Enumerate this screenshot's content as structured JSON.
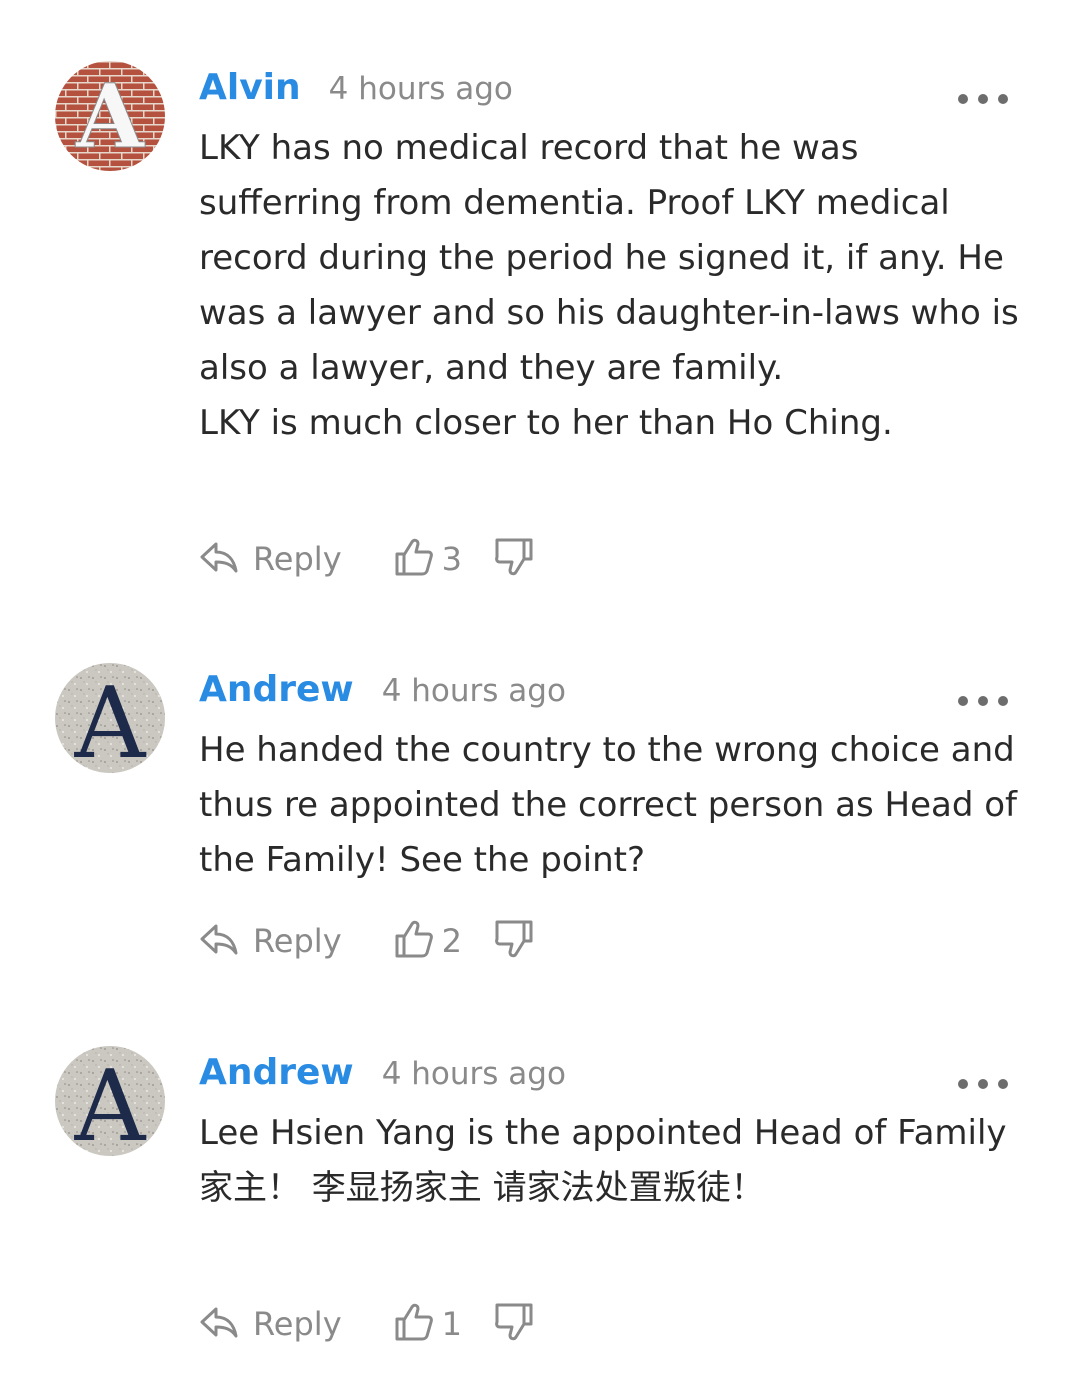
{
  "comments": [
    {
      "author": "Alvin",
      "time": "4 hours ago",
      "avatar_letter": "A",
      "avatar_style": "brick",
      "paragraphs": [
        "LKY has no medical record that he was sufferring from dementia. Proof LKY medical record during the period he signed it, if any. He was a lawyer and so his daughter-in-laws who is also a lawyer, and they are family.",
        "LKY is much closer to her than Ho Ching."
      ],
      "reply_label": "Reply",
      "likes": "3"
    },
    {
      "author": "Andrew",
      "time": "4 hours ago",
      "avatar_letter": "A",
      "avatar_style": "granite",
      "paragraphs": [
        "He handed the country to the wrong choice and thus re appointed the correct person as Head of the Family! See the point?"
      ],
      "reply_label": "Reply",
      "likes": "2"
    },
    {
      "author": "Andrew",
      "time": "4 hours ago",
      "avatar_letter": "A",
      "avatar_style": "granite",
      "paragraphs": [
        "Lee Hsien Yang is the appointed Head of Family",
        "家主！ 李显扬家主 请家法处置叛徒！"
      ],
      "reply_label": "Reply",
      "likes": "1"
    }
  ],
  "colors": {
    "author": "#2a8be3",
    "meta": "#8a8a8a",
    "text": "#2a2a2a",
    "brick": "#b5523f",
    "granite": "#c9c6c0",
    "avatar_letter_on_granite": "#1d2a4a"
  },
  "icons": {
    "more": "more-dots-icon",
    "reply": "reply-arrow-icon",
    "like": "thumbs-up-icon",
    "dislike": "thumbs-down-icon"
  }
}
